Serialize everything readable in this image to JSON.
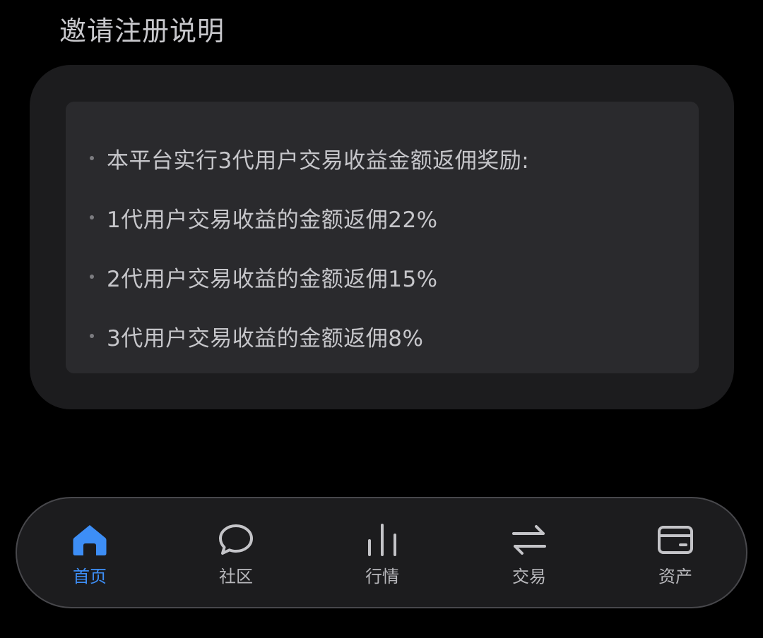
{
  "section": {
    "title": "邀请注册说明"
  },
  "rules": [
    "本平台实行3代用户交易收益金额返佣奖励:",
    "1代用户交易收益的金额返佣22%",
    "2代用户交易收益的金额返佣15%",
    "3代用户交易收益的金额返佣8%"
  ],
  "tabbar": {
    "items": [
      {
        "label": "首页",
        "icon": "home-icon",
        "active": true
      },
      {
        "label": "社区",
        "icon": "chat-bubble-icon",
        "active": false
      },
      {
        "label": "行情",
        "icon": "bar-chart-icon",
        "active": false
      },
      {
        "label": "交易",
        "icon": "swap-arrows-icon",
        "active": false
      },
      {
        "label": "资产",
        "icon": "wallet-icon",
        "active": false
      }
    ]
  },
  "colors": {
    "background": "#000000",
    "card_outer": "#1c1c1e",
    "card_inner": "#2a2a2d",
    "accent": "#3d8ef6",
    "text": "#c6c6ca",
    "icon_inactive": "#c4c4c8"
  }
}
